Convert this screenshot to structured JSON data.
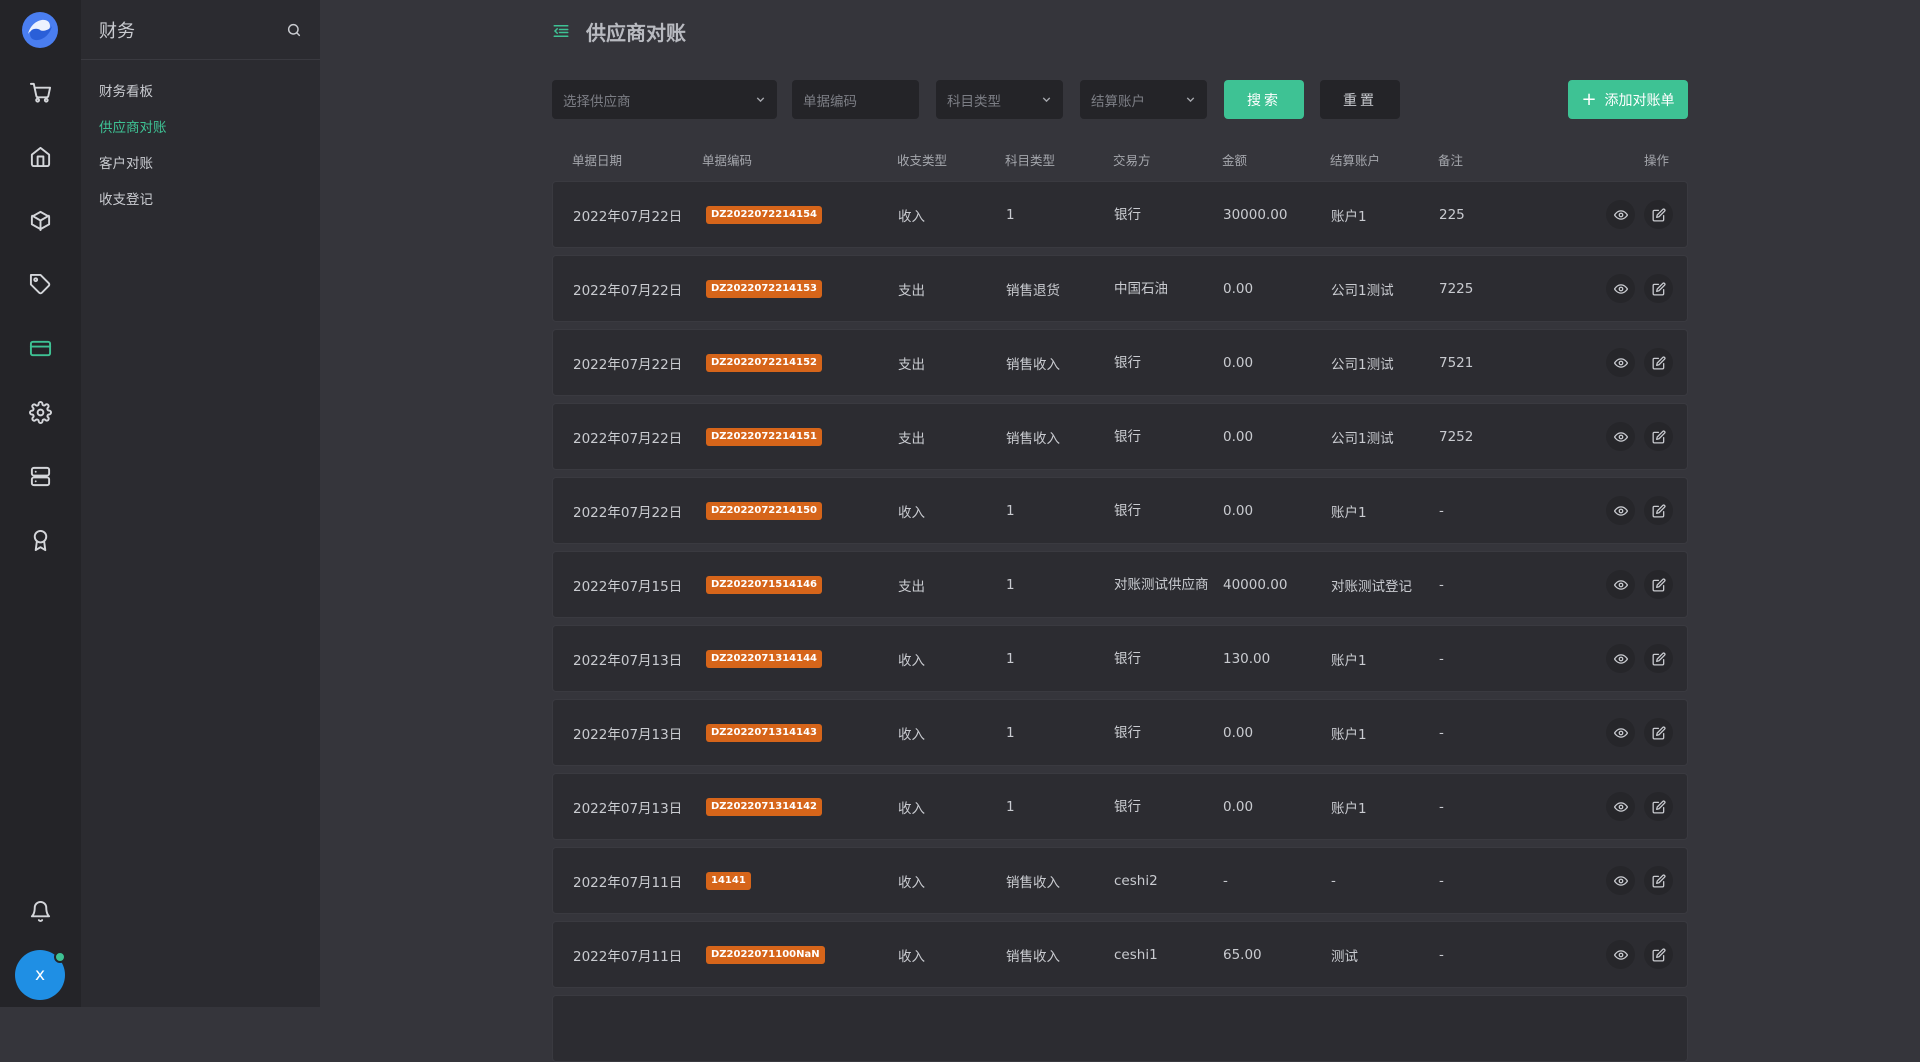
{
  "rail": {
    "icons": [
      "cart-icon",
      "home-icon",
      "box-icon",
      "tag-icon",
      "card-icon",
      "gear-icon",
      "server-icon",
      "award-icon"
    ],
    "active": "card-icon",
    "bell": "bell-icon",
    "avatar_letter": "x"
  },
  "submenu": {
    "title": "财务",
    "items": [
      {
        "label": "财务看板"
      },
      {
        "label": "供应商对账"
      },
      {
        "label": "客户对账"
      },
      {
        "label": "收支登记"
      }
    ],
    "active_index": 1
  },
  "page": {
    "title": "供应商对账"
  },
  "filters": {
    "supplier_placeholder": "选择供应商",
    "code_placeholder": "单据编码",
    "subject_placeholder": "科目类型",
    "account_placeholder": "结算账户",
    "search_label": "搜索",
    "reset_label": "重置",
    "add_label": "添加对账单"
  },
  "table": {
    "headers": {
      "date": "单据日期",
      "code": "单据编码",
      "io": "收支类型",
      "subject": "科目类型",
      "party": "交易方",
      "amount": "金额",
      "account": "结算账户",
      "remark": "备注",
      "ops": "操作"
    },
    "rows": [
      {
        "date": "2022年07月22日",
        "code": "DZ2022072214154",
        "io": "收入",
        "subject": "1",
        "party": "银行",
        "amount": "30000.00",
        "account": "账户1",
        "remark": "225"
      },
      {
        "date": "2022年07月22日",
        "code": "DZ2022072214153",
        "io": "支出",
        "subject": "销售退货",
        "party": "中国石油",
        "amount": "0.00",
        "account": "公司1测试",
        "remark": "7225"
      },
      {
        "date": "2022年07月22日",
        "code": "DZ2022072214152",
        "io": "支出",
        "subject": "销售收入",
        "party": "银行",
        "amount": "0.00",
        "account": "公司1测试",
        "remark": "7521"
      },
      {
        "date": "2022年07月22日",
        "code": "DZ2022072214151",
        "io": "支出",
        "subject": "销售收入",
        "party": "银行",
        "amount": "0.00",
        "account": "公司1测试",
        "remark": "7252"
      },
      {
        "date": "2022年07月22日",
        "code": "DZ2022072214150",
        "io": "收入",
        "subject": "1",
        "party": "银行",
        "amount": "0.00",
        "account": "账户1",
        "remark": "-"
      },
      {
        "date": "2022年07月15日",
        "code": "DZ2022071514146",
        "io": "支出",
        "subject": "1",
        "party": "对账测试供应商",
        "amount": "40000.00",
        "account": "对账测试登记",
        "remark": "-"
      },
      {
        "date": "2022年07月13日",
        "code": "DZ2022071314144",
        "io": "收入",
        "subject": "1",
        "party": "银行",
        "amount": "130.00",
        "account": "账户1",
        "remark": "-"
      },
      {
        "date": "2022年07月13日",
        "code": "DZ2022071314143",
        "io": "收入",
        "subject": "1",
        "party": "银行",
        "amount": "0.00",
        "account": "账户1",
        "remark": "-"
      },
      {
        "date": "2022年07月13日",
        "code": "DZ2022071314142",
        "io": "收入",
        "subject": "1",
        "party": "银行",
        "amount": "0.00",
        "account": "账户1",
        "remark": "-"
      },
      {
        "date": "2022年07月11日",
        "code": "14141",
        "io": "收入",
        "subject": "销售收入",
        "party": "ceshi2",
        "amount": "-",
        "account": "-",
        "remark": "-"
      },
      {
        "date": "2022年07月11日",
        "code": "DZ2022071100NaN",
        "io": "收入",
        "subject": "销售收入",
        "party": "ceshi1",
        "amount": "65.00",
        "account": "测试",
        "remark": "-"
      }
    ]
  },
  "colors": {
    "accent": "#3ec294",
    "badge": "#d6651a",
    "avatar": "#1f8fe4"
  }
}
